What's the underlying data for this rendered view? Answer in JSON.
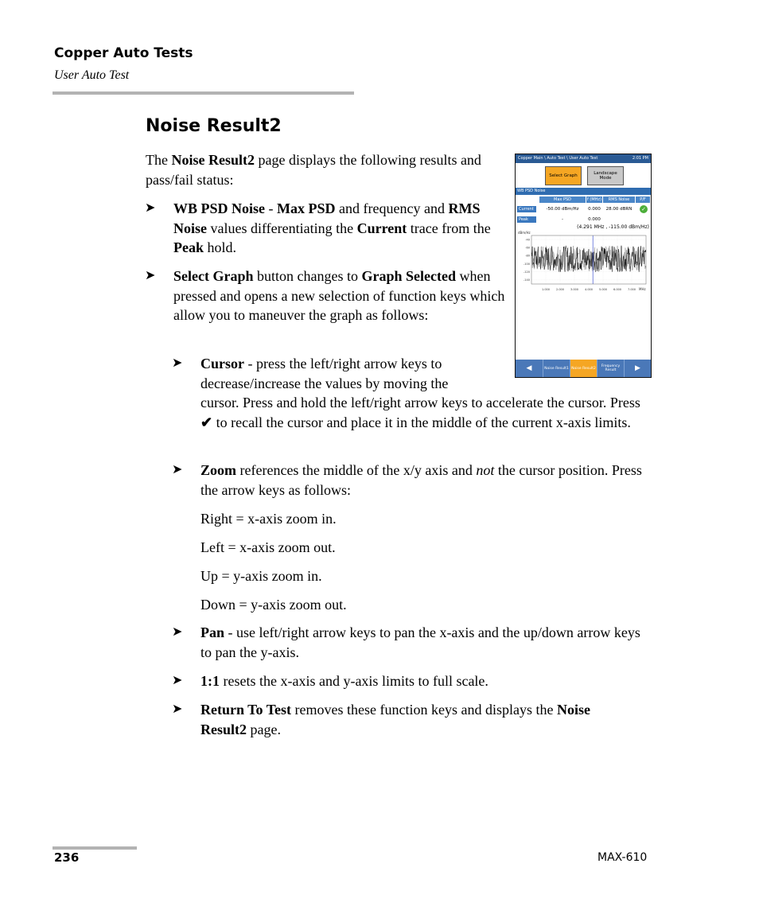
{
  "header": {
    "chapter": "Copper Auto Tests",
    "section": "User Auto Test"
  },
  "section_title": "Noise Result2",
  "intro": {
    "t1": "The ",
    "b1": "Noise Result2",
    "t2": " page displays the following results and pass/fail status:"
  },
  "bullets": {
    "wb": {
      "b1": "WB PSD Noise",
      "t1": " - ",
      "b2": "Max PSD",
      "t2": " and frequency and ",
      "b3": "RMS Noise",
      "t3": " values differentiating the ",
      "b4": "Current",
      "t4": " trace from the ",
      "b5": "Peak",
      "t5": " hold."
    },
    "select": {
      "b1": "Select Graph",
      "t1": " button changes to ",
      "b2": "Graph Selected",
      "t2": " when pressed and opens a new selection of function keys which allow you to maneuver the graph as follows:"
    },
    "cursor": {
      "b1": "Cursor",
      "t1": " - press the left/right arrow keys to decrease/increase the values by moving the cursor. Press and hold the left/right arrow keys to accelerate the cursor. Press ",
      "icon": "✔",
      "t2": " to recall the cursor and place it in the middle of the current x-axis limits."
    },
    "zoom": {
      "b1": "Zoom",
      "t1": " references the middle of the x/y axis and ",
      "i1": "not",
      "t2": " the cursor position. Press the arrow keys as follows:",
      "lines": [
        "Right = x-axis zoom in.",
        "Left = x-axis zoom out.",
        "Up = y-axis zoom in.",
        "Down = y-axis zoom out."
      ]
    },
    "pan": {
      "b1": "Pan",
      "t1": " - use left/right arrow keys to pan the x-axis and the up/down arrow keys to pan the y-axis."
    },
    "one": {
      "b1": "1:1",
      "t1": " resets the x-axis and y-axis limits to full scale."
    },
    "ret": {
      "b1": "Return To Test",
      "t1": " removes these function keys and displays the ",
      "b2": "Noise Result2",
      "t2": " page."
    },
    "arrow": "➤"
  },
  "device": {
    "breadcrumb": "Copper Main \\ Auto Test \\ User Auto Test",
    "time": "2:01 PM",
    "select_graph": "Select Graph",
    "landscape_mode": "Landscape Mode",
    "section": "WB PSD Noise",
    "columns": [
      "Max PSD",
      "f (MHz)",
      "RMS Noise",
      "P/F"
    ],
    "rows": [
      {
        "label": "Current",
        "max_psd": "-50.00 dBm/Hz",
        "freq": "0.000",
        "rms": "28.00 dBRN",
        "pf": "pass"
      },
      {
        "label": "Peak",
        "max_psd": "-",
        "freq": "0.000",
        "rms": "",
        "pf": ""
      }
    ],
    "cursor_readout": "(4.291 MHz , -115.00 dBm/Hz)",
    "nav": {
      "prev": "◀",
      "tabs": [
        "Noise Result1",
        "Noise Result2",
        "Frequency Result"
      ],
      "active_tab": "Noise Result2",
      "next": "▶"
    },
    "colors": {
      "accent": "#f5a623",
      "titlebar": "#2a5a94",
      "header": "#2f6cb0",
      "pass": "#4cae3a"
    }
  },
  "chart_data": {
    "type": "line",
    "title": "",
    "xlabel": "MHz",
    "ylabel": "dBm/Hz",
    "xlim": [
      0,
      8
    ],
    "ylim": [
      -150,
      -30
    ],
    "x_ticks": [
      "1.000",
      "2.000",
      "3.000",
      "4.000",
      "5.000",
      "6.000",
      "7.000"
    ],
    "y_ticks": [
      "-40",
      "-60",
      "-80",
      "-100",
      "-120",
      "-140"
    ],
    "cursor_x": 4.291,
    "series": [
      {
        "name": "Current",
        "color": "#000000",
        "range": [
          -120,
          -55
        ],
        "mean": -90
      },
      {
        "name": "Peak",
        "color": "#888888",
        "range": [
          -118,
          -55
        ],
        "mean": -88
      }
    ],
    "grid": true
  },
  "footer": {
    "page_number": "236",
    "model": "MAX-610"
  }
}
